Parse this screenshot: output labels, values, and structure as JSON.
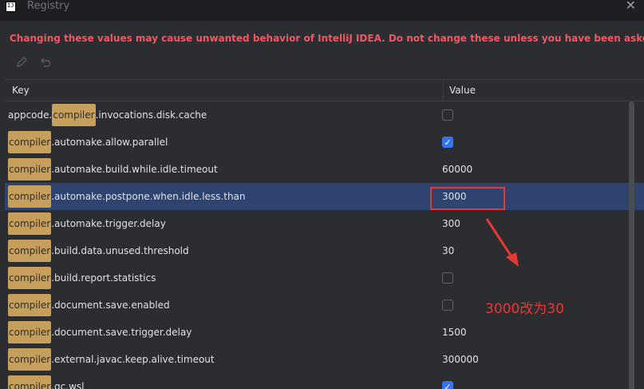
{
  "window": {
    "title": "Registry",
    "close_glyph": "✕"
  },
  "warning": {
    "text": "Changing these values may cause unwanted behavior of IntelliJ IDEA. Do not change these unless you have been asked to.",
    "color": "#f75464"
  },
  "toolbar": {
    "edit_icon": "pencil-icon",
    "revert_icon": "undo-icon"
  },
  "table": {
    "headers": {
      "key": "Key",
      "value": "Value"
    },
    "highlight_term": "compiler",
    "rows": [
      {
        "prefix": "appcode.",
        "hl": "compiler",
        "rest": ".invocations.disk.cache",
        "type": "checkbox",
        "checked": false,
        "value": ""
      },
      {
        "prefix": "",
        "hl": "compiler",
        "rest": ".automake.allow.parallel",
        "type": "checkbox",
        "checked": true,
        "value": ""
      },
      {
        "prefix": "",
        "hl": "compiler",
        "rest": ".automake.build.while.idle.timeout",
        "type": "text",
        "value": "60000"
      },
      {
        "prefix": "",
        "hl": "compiler",
        "rest": ".automake.postpone.when.idle.less.than",
        "type": "text",
        "value": "3000",
        "selected": true
      },
      {
        "prefix": "",
        "hl": "compiler",
        "rest": ".automake.trigger.delay",
        "type": "text",
        "value": "300"
      },
      {
        "prefix": "",
        "hl": "compiler",
        "rest": ".build.data.unused.threshold",
        "type": "text",
        "value": "30"
      },
      {
        "prefix": "",
        "hl": "compiler",
        "rest": ".build.report.statistics",
        "type": "checkbox",
        "checked": false,
        "value": ""
      },
      {
        "prefix": "",
        "hl": "compiler",
        "rest": ".document.save.enabled",
        "type": "checkbox",
        "checked": false,
        "value": ""
      },
      {
        "prefix": "",
        "hl": "compiler",
        "rest": ".document.save.trigger.delay",
        "type": "text",
        "value": "1500"
      },
      {
        "prefix": "",
        "hl": "compiler",
        "rest": ".external.javac.keep.alive.timeout",
        "type": "text",
        "value": "300000"
      },
      {
        "prefix": "",
        "hl": "compiler",
        "rest": ".gc.wsl",
        "type": "checkbox",
        "checked": true,
        "value": ""
      }
    ]
  },
  "annotation": {
    "text": "3000改为30",
    "color": "#e53935"
  }
}
